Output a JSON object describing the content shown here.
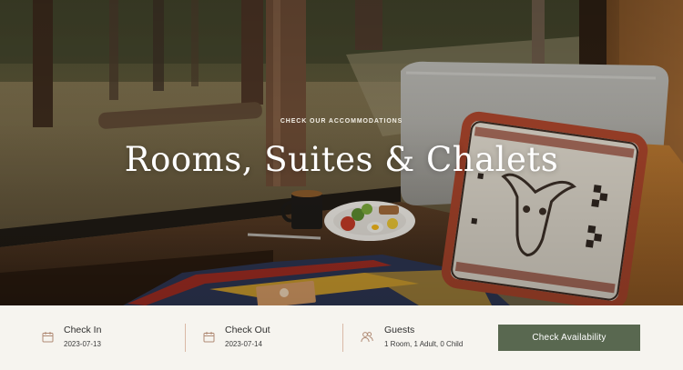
{
  "hero": {
    "eyebrow": "CHECK OUR ACCOMMODATIONS",
    "title": "Rooms, Suites & Chalets"
  },
  "booking": {
    "check_in": {
      "label": "Check In",
      "value": "2023-07-13",
      "icon": "calendar-icon"
    },
    "check_out": {
      "label": "Check Out",
      "value": "2023-07-14",
      "icon": "calendar-icon"
    },
    "guests": {
      "label": "Guests",
      "value": "1 Room, 1 Adult, 0 Child",
      "icon": "users-icon"
    },
    "cta_label": "Check Availability"
  },
  "colors": {
    "accent": "#596850",
    "background": "#f6f4ef",
    "divider": "#d9b9a6",
    "icon": "#b08a74"
  }
}
